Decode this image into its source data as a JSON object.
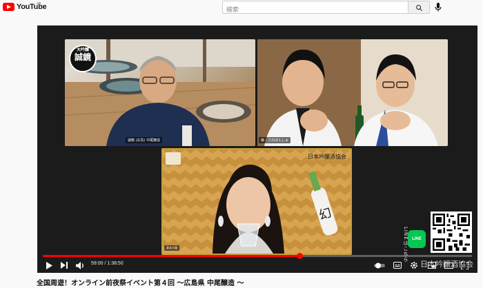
{
  "header": {
    "logo_text": "YouTube",
    "logo_glyph": "JP",
    "search": {
      "placeholder": "検索",
      "value": ""
    },
    "icons": [
      "youtube-logo-icon",
      "search-icon",
      "microphone-icon"
    ]
  },
  "player": {
    "tiles": [
      {
        "name": "brewery-speaker",
        "label": "誠鏡 (広島) 中尾醸造",
        "logo_top": "大吟醸",
        "logo_main": "誠鏡"
      },
      {
        "name": "guests",
        "label": "森・さのぼんしゅ"
      },
      {
        "name": "host",
        "label": "栗本小瑠",
        "brand": "日本吟醸酒協会"
      }
    ],
    "overlay": {
      "line_text": "LINEはこちら",
      "line_badge": "LINE",
      "watermark": "日本吟醸酒協会"
    },
    "controls": {
      "current_time": "59:00",
      "duration": "1:38:50",
      "time_display": "59:00 / 1:38:50",
      "progress": 0.598
    },
    "colors": {
      "progress": "#ff0000",
      "line": "#06c755"
    }
  },
  "video": {
    "title": "全国周遊！オンライン前夜祭イベント第４回 〜広島県 中尾醸造 〜"
  }
}
